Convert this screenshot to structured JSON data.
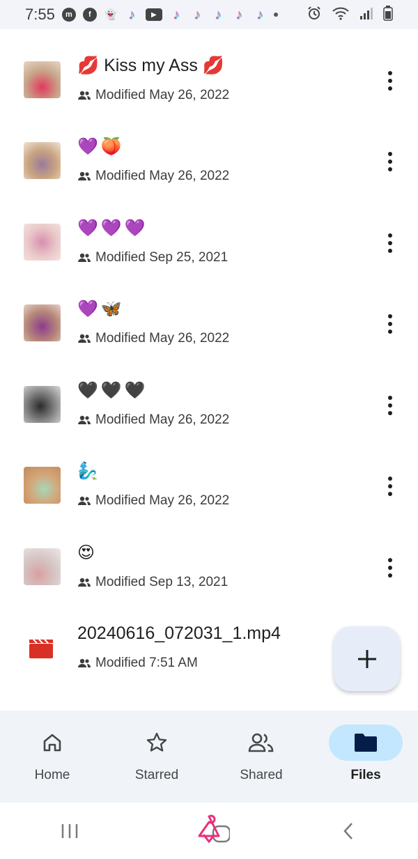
{
  "status_bar": {
    "time": "7:55",
    "icons": [
      "messenger-icon",
      "facebook-icon",
      "snapchat-icon",
      "tiktok-icon",
      "youtube-icon",
      "tiktok-icon",
      "tiktok-icon",
      "tiktok-icon",
      "tiktok-icon",
      "tiktok-icon",
      "dot-icon"
    ],
    "right_icons": [
      "alarm-icon",
      "wifi-icon",
      "signal-icon",
      "battery-icon"
    ]
  },
  "files": [
    {
      "title": "💋 Kiss my Ass 💋",
      "modified": "Modified May 26, 2022",
      "thumb_color": "#d84a6b",
      "kind": "image"
    },
    {
      "title": "💜🍑",
      "modified": "Modified May 26, 2022",
      "thumb_color": "#b08a6a",
      "kind": "image"
    },
    {
      "title": "💜💜💜",
      "modified": "Modified Sep 25, 2021",
      "thumb_color": "#e8b4c0",
      "kind": "image"
    },
    {
      "title": "💜🦋",
      "modified": "Modified May 26, 2022",
      "thumb_color": "#a36a9c",
      "kind": "image"
    },
    {
      "title": "🖤🖤🖤",
      "modified": "Modified May 26, 2022",
      "thumb_color": "#6a6a6a",
      "kind": "image"
    },
    {
      "title": "🧞‍♂️",
      "modified": "Modified May 26, 2022",
      "thumb_color": "#c8a070",
      "kind": "image"
    },
    {
      "title": "😍",
      "modified": "Modified Sep 13, 2021",
      "thumb_color": "#c9b3b3",
      "kind": "image"
    },
    {
      "title": "20240616_072031_1.mp4",
      "modified": "Modified 7:51 AM",
      "thumb_color": "#d93025",
      "kind": "video"
    }
  ],
  "fab": {
    "icon": "plus-icon"
  },
  "bottom_nav": [
    {
      "label": "Home",
      "icon": "home-icon",
      "active": false
    },
    {
      "label": "Starred",
      "icon": "star-icon",
      "active": false
    },
    {
      "label": "Shared",
      "icon": "people-icon",
      "active": false
    },
    {
      "label": "Files",
      "icon": "folder-icon",
      "active": true
    }
  ],
  "system_nav": [
    "recents-icon",
    "home-button-icon",
    "back-icon"
  ],
  "colors": {
    "accent": "#c2e7ff",
    "nav_bg": "#f0f4f9",
    "fab_bg": "#e6edf9",
    "video_red": "#d93025"
  }
}
